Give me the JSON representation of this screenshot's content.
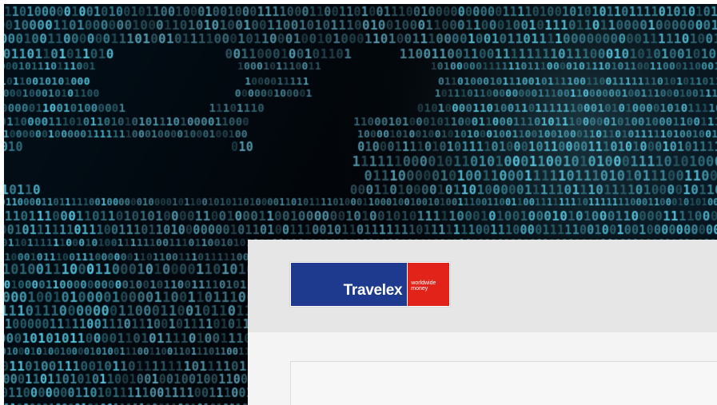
{
  "logo": {
    "wordmark": "Travelex",
    "tagline": "worldwide money",
    "colors": {
      "blue": "#1d3a8e",
      "red": "#e2231a"
    }
  },
  "background": {
    "description_free": true,
    "theme_color": "#6fd2e8"
  }
}
